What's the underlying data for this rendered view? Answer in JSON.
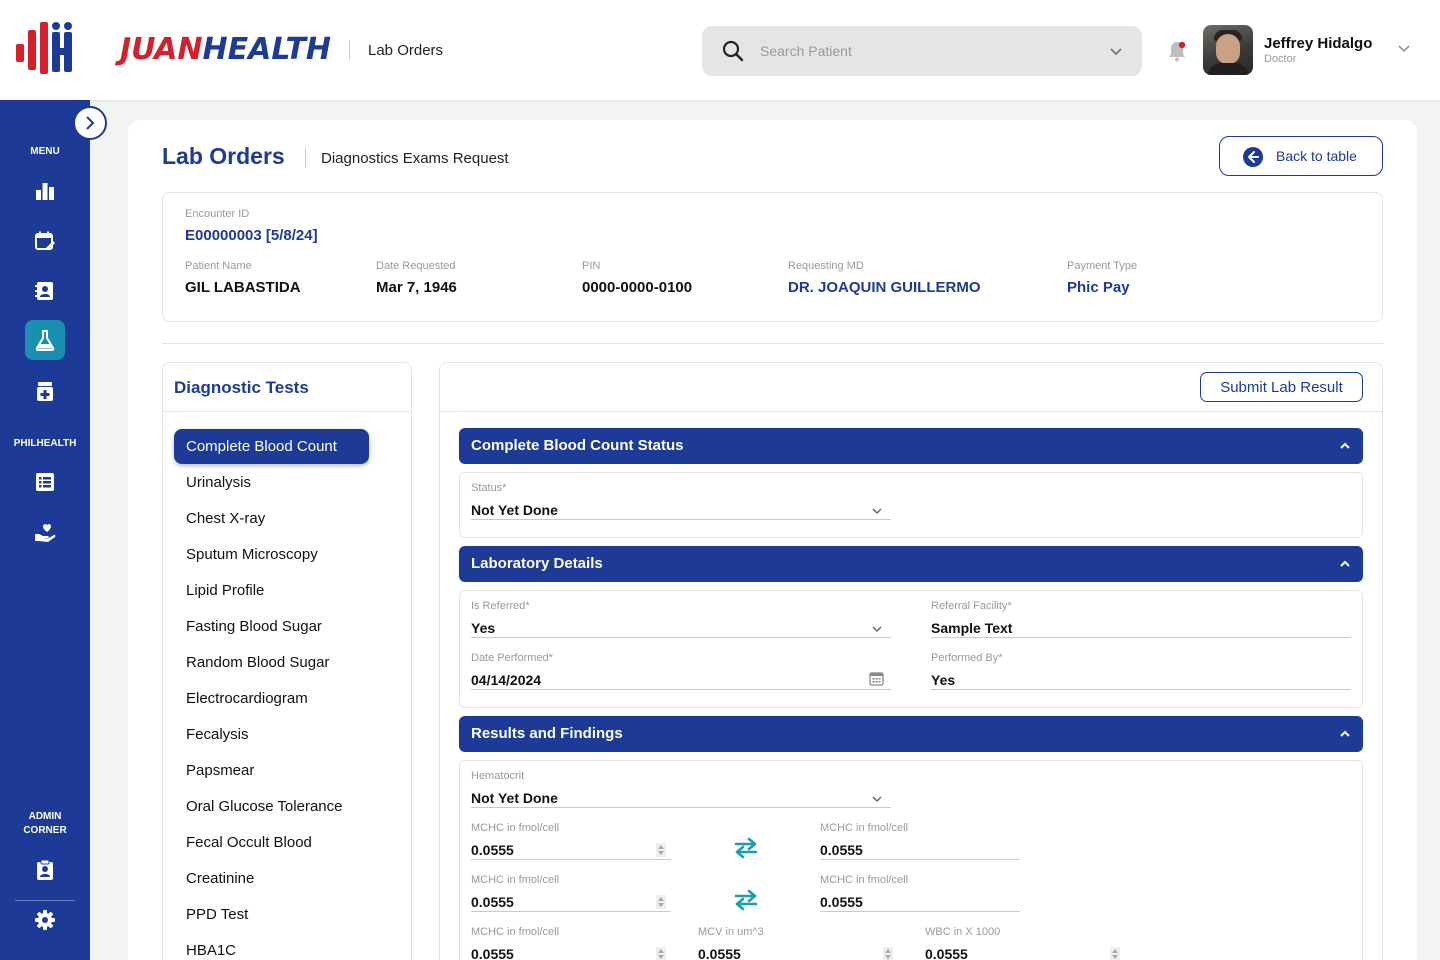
{
  "header": {
    "brand_part1": "JUAN",
    "brand_part2": "HEALTH",
    "section": "Lab Orders",
    "search_placeholder": "Search Patient",
    "user_name": "Jeffrey Hidalgo",
    "user_role": "Doctor"
  },
  "sidebar": {
    "menu_label": "MENU",
    "philhealth_label": "PHILHEALTH",
    "admin_label_line1": "ADMIN",
    "admin_label_line2": "CORNER"
  },
  "page": {
    "title": "Lab Orders",
    "subtitle": "Diagnostics Exams Request",
    "back_label": "Back to table"
  },
  "encounter": {
    "id_label": "Encounter ID",
    "id_value": "E00000003 [5/8/24]",
    "patient_label": "Patient Name",
    "patient_value": "GIL LABASTIDA",
    "date_label": "Date Requested",
    "date_value": "Mar 7, 1946",
    "pin_label": "PIN",
    "pin_value": "0000-0000-0100",
    "md_label": "Requesting MD",
    "md_value": "DR. JOAQUIN GUILLERMO",
    "payment_label": "Payment Type",
    "payment_value": "Phic Pay"
  },
  "tests": {
    "title": "Diagnostic Tests",
    "items": [
      "Complete Blood Count",
      "Urinalysis",
      "Chest X-ray",
      "Sputum Microscopy",
      "Lipid Profile",
      "Fasting Blood Sugar",
      "Random Blood Sugar",
      "Electrocardiogram",
      "Fecalysis",
      "Papsmear",
      "Oral Glucose Tolerance",
      "Fecal Occult Blood",
      "Creatinine",
      "PPD Test",
      "HBA1C"
    ]
  },
  "form": {
    "submit_label": "Submit Lab Result",
    "status_section": {
      "title": "Complete Blood Count Status",
      "status_label": "Status*",
      "status_value": "Not Yet Done"
    },
    "lab_section": {
      "title": "Laboratory Details",
      "referred_label": "Is Referred*",
      "referred_value": "Yes",
      "facility_label": "Referral Facility*",
      "facility_value": "Sample Text",
      "date_label": "Date Performed*",
      "date_value": "04/14/2024",
      "performed_label": "Performed By*",
      "performed_value": "Yes"
    },
    "results_section": {
      "title": "Results and Findings",
      "hematocrit_label": "Hematocrit",
      "hematocrit_value": "Not Yet Done",
      "row1_left_label": "MCHC in fmol/cell",
      "row1_left_value": "0.0555",
      "row1_right_label": "MCHC in fmol/cell",
      "row1_right_value": "0.0555",
      "row2_left_label": "MCHC in fmol/cell",
      "row2_left_value": "0.0555",
      "row2_right_label": "MCHC in fmol/cell",
      "row2_right_value": "0.0555",
      "row3_a_label": "MCHC in fmol/cell",
      "row3_a_value": "0.0555",
      "row3_b_label": "MCV in um^3",
      "row3_b_value": "0.0555",
      "row3_c_label": "WBC in X 1000",
      "row3_c_value": "0.0555"
    }
  },
  "colors": {
    "primary": "#1d3b96",
    "brand_red": "#d51f2b",
    "active_nav": "#1a8fb0",
    "swap_icon": "#1a9fb0"
  },
  "icons": [
    "logo-mark-icon",
    "search-icon",
    "chevron-down-icon",
    "bell-icon",
    "chevron-right-icon",
    "bar-chart-icon",
    "calendar-edit-icon",
    "contact-card-icon",
    "flask-icon",
    "medkit-icon",
    "list-icon",
    "heart-hand-icon",
    "clipboard-user-icon",
    "gear-icon",
    "arrow-left-circle-icon",
    "chevron-up-icon",
    "swap-arrows-icon",
    "calendar-icon",
    "spinner-arrows-icon"
  ]
}
